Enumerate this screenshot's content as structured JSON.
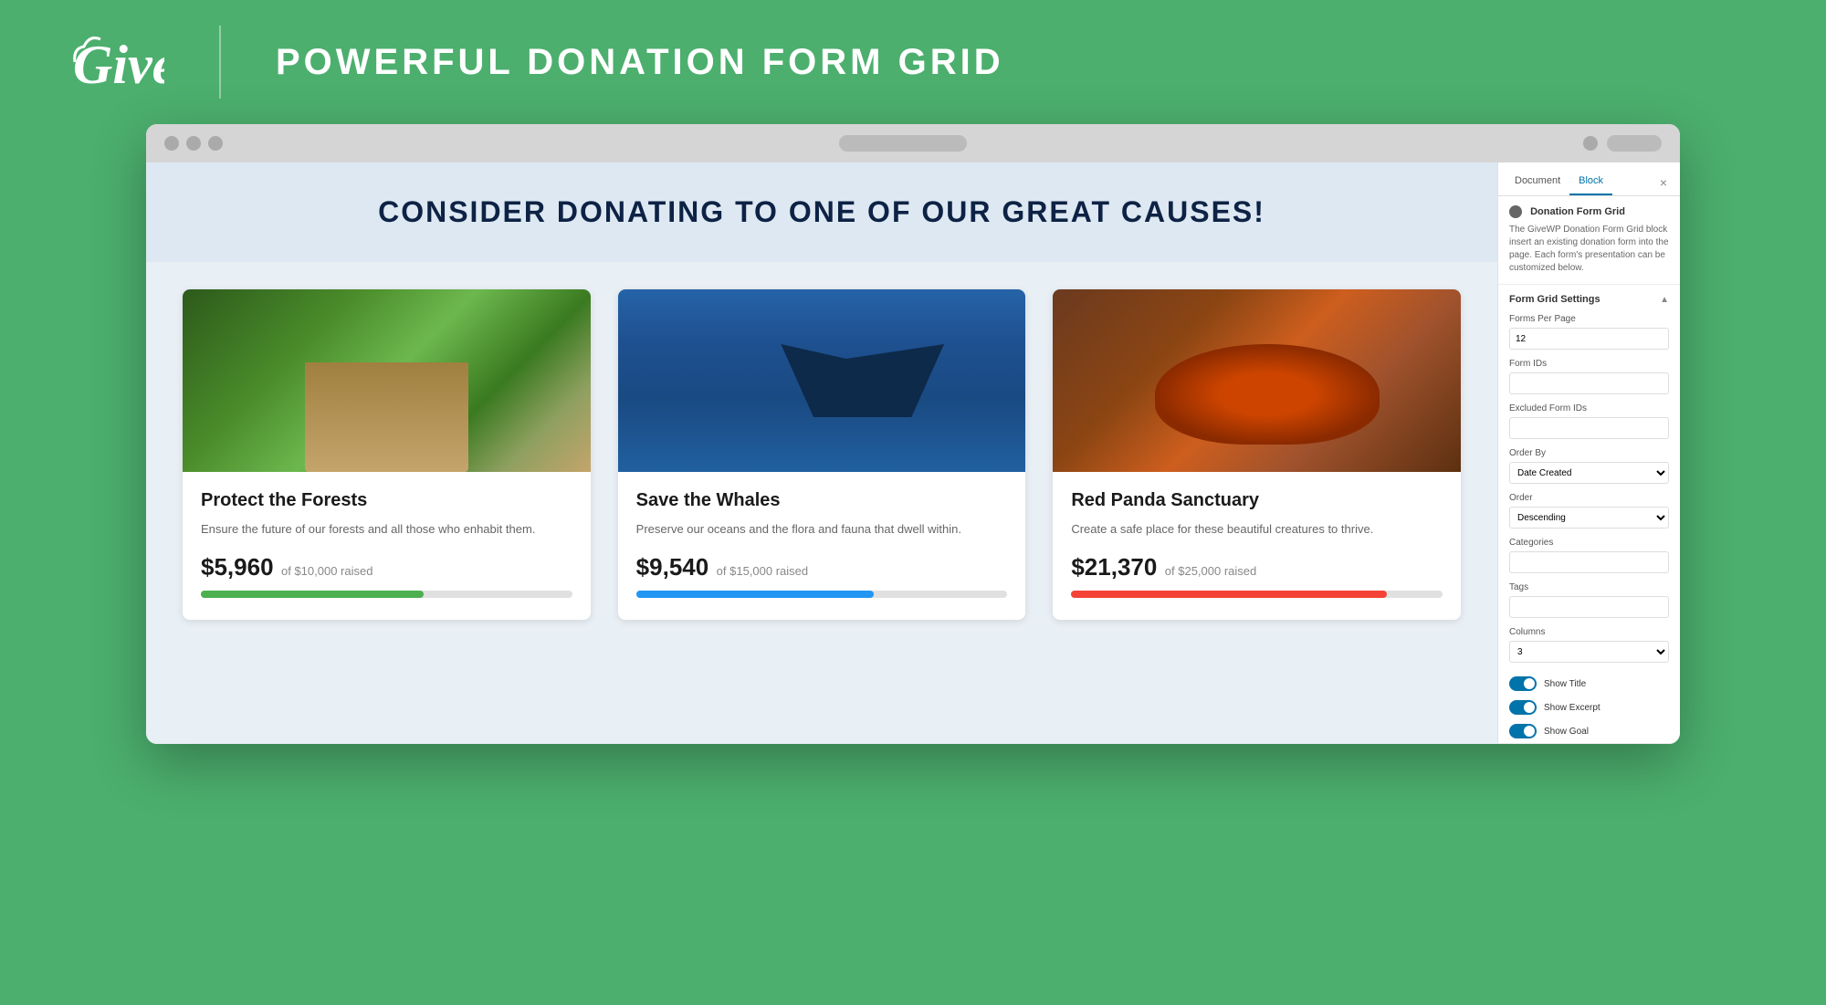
{
  "header": {
    "logo": "Give",
    "title": "POWERFUL DONATION FORM GRID"
  },
  "browser": {
    "url_bar": "",
    "tabs": {
      "document": "Document",
      "block": "Block"
    }
  },
  "page": {
    "banner_title": "CONSIDER DONATING TO ONE OF OUR GREAT CAUSES!"
  },
  "cards": [
    {
      "title": "Protect the Forests",
      "description": "Ensure the future of our forests and all those who enhabit them.",
      "amount": "$5,960",
      "raised_text": "of $10,000 raised",
      "progress": 60,
      "progress_color": "green",
      "image_type": "forest"
    },
    {
      "title": "Save the Whales",
      "description": "Preserve our oceans and the flora and fauna that dwell within.",
      "amount": "$9,540",
      "raised_text": "of $15,000 raised",
      "progress": 64,
      "progress_color": "blue",
      "image_type": "whale"
    },
    {
      "title": "Red Panda Sanctuary",
      "description": "Create a safe place for these beautiful creatures to thrive.",
      "amount": "$21,370",
      "raised_text": "of $25,000 raised",
      "progress": 85,
      "progress_color": "red",
      "image_type": "panda"
    }
  ],
  "sidebar": {
    "document_tab": "Document",
    "block_tab": "Block",
    "close_label": "×",
    "block_icon_label": "●",
    "block_name": "Donation Form Grid",
    "block_description": "The GiveWP Donation Form Grid block insert an existing donation form into the page. Each form's presentation can be customized below.",
    "form_grid_settings": "Form Grid Settings",
    "fields": {
      "forms_per_page_label": "Forms Per Page",
      "forms_per_page_value": "12",
      "form_ids_label": "Form IDs",
      "form_ids_value": "",
      "excluded_form_ids_label": "Excluded Form IDs",
      "excluded_form_ids_value": "",
      "order_by_label": "Order By",
      "order_by_value": "Date Created",
      "order_label": "Order",
      "order_value": "Descending",
      "categories_label": "Categories",
      "categories_value": "",
      "tags_label": "Tags",
      "tags_value": "",
      "columns_label": "Columns",
      "columns_value": "3"
    },
    "toggles": [
      {
        "label": "Show Title",
        "enabled": true
      },
      {
        "label": "Show Excerpt",
        "enabled": true
      },
      {
        "label": "Show Goal",
        "enabled": true
      }
    ]
  }
}
